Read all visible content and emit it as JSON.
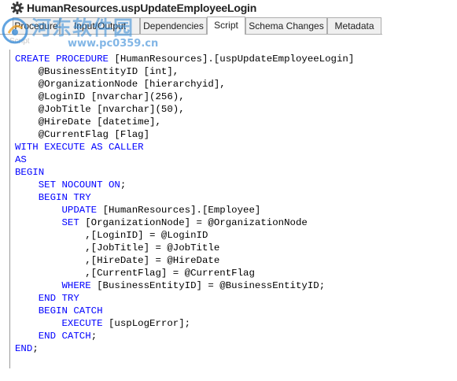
{
  "window": {
    "title": "HumanResources.uspUpdateEmployeeLogin",
    "icon": "gear-icon"
  },
  "tabs": [
    {
      "label": "Procedure",
      "active": false
    },
    {
      "label": "Input/Output",
      "active": false
    },
    {
      "label": "Dependencies",
      "active": false
    },
    {
      "label": "Script",
      "active": true
    },
    {
      "label": "Schema Changes",
      "active": false
    },
    {
      "label": "Metadata",
      "active": false
    }
  ],
  "panel_label": "Script",
  "watermark": {
    "title": "河东软件园",
    "url": "www.pc0359.cn"
  },
  "code_lines": [
    "CREATE PROCEDURE [HumanResources].[uspUpdateEmployeeLogin]",
    "    @BusinessEntityID [int],",
    "    @OrganizationNode [hierarchyid],",
    "    @LoginID [nvarchar](256),",
    "    @JobTitle [nvarchar](50),",
    "    @HireDate [datetime],",
    "    @CurrentFlag [Flag]",
    "WITH EXECUTE AS CALLER",
    "AS",
    "BEGIN",
    "    SET NOCOUNT ON;",
    "    BEGIN TRY",
    "        UPDATE [HumanResources].[Employee]",
    "        SET [OrganizationNode] = @OrganizationNode",
    "            ,[LoginID] = @LoginID",
    "            ,[JobTitle] = @JobTitle",
    "            ,[HireDate] = @HireDate",
    "            ,[CurrentFlag] = @CurrentFlag",
    "        WHERE [BusinessEntityID] = @BusinessEntityID;",
    "    END TRY",
    "    BEGIN CATCH",
    "        EXECUTE [uspLogError];",
    "    END CATCH;",
    "END;"
  ],
  "keywords": [
    "CREATE",
    "PROCEDURE",
    "WITH",
    "EXECUTE",
    "AS",
    "BEGIN",
    "SET",
    "NOCOUNT",
    "ON",
    "UPDATE",
    "WHERE",
    "END",
    "TRY",
    "CATCH",
    "CALLER"
  ],
  "colors": {
    "keyword": "#0000ff",
    "text": "#000000",
    "tab_border": "#adadad",
    "watermark": "#2e86d6"
  }
}
